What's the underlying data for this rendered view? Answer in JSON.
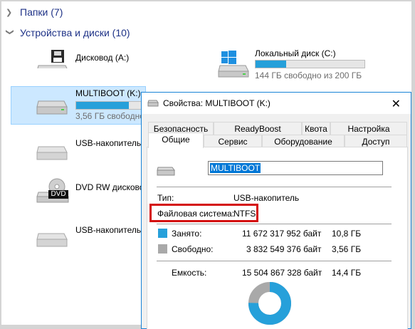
{
  "groups": {
    "folders": "Папки (7)",
    "devices": "Устройства и диски (10)"
  },
  "drives": [
    {
      "name": "Дисковод (A:)"
    },
    {
      "name": "Локальный диск (C:)",
      "free": "144 ГБ свободно из 200 ГБ",
      "used_fraction": 0.28
    },
    {
      "name": "MULTIBOOT (K:)",
      "free": "3,56 ГБ свободно",
      "used_fraction": 0.75
    },
    {
      "name": "USB-накопитель"
    },
    {
      "name": "DVD RW дисковод"
    },
    {
      "name": "USB-накопитель"
    }
  ],
  "dvd_badge": "DVD",
  "dialog": {
    "title": "Свойства: MULTIBOOT (K:)",
    "tabs_row1": [
      "Безопасность",
      "ReadyBoost",
      "Квота",
      "Настройка"
    ],
    "tabs_row2": [
      "Общие",
      "Сервис",
      "Оборудование",
      "Доступ"
    ],
    "label_value": "MULTIBOOT",
    "type_label": "Тип:",
    "type_value": "USB-накопитель",
    "fs_label": "Файловая система:",
    "fs_value": "NTFS",
    "used_label": "Занято:",
    "used_bytes": "11 672 317 952 байт",
    "used_size": "10,8 ГБ",
    "free_label": "Свободно:",
    "free_bytes": "3 832 549 376 байт",
    "free_size": "3,56 ГБ",
    "cap_label": "Емкость:",
    "cap_bytes": "15 504 867 328 байт",
    "cap_size": "14,4 ГБ",
    "used_fraction": 0.753
  },
  "colors": {
    "used": "#26a0da",
    "free": "#a9a9a9",
    "highlight": "#d40d0d"
  }
}
